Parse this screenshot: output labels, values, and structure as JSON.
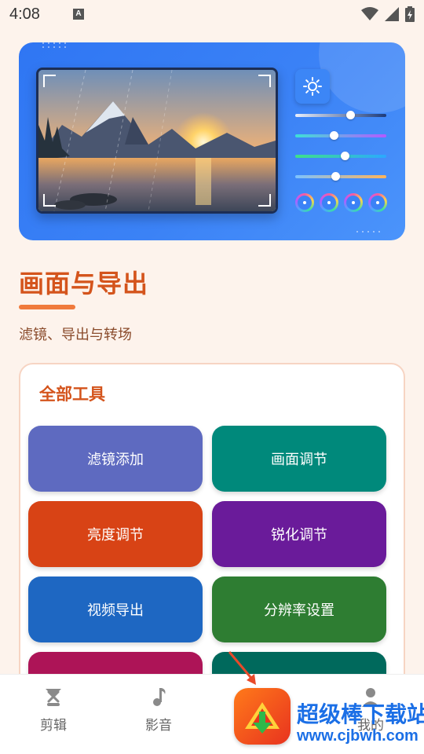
{
  "status_bar": {
    "time": "4:08",
    "notification_icon": "a-icon",
    "wifi_icon": "wifi-icon",
    "signal_icon": "signal-icon",
    "battery_icon": "battery-charging-icon"
  },
  "hero": {
    "image": "mountain-lake-sunset-photo",
    "icons": [
      "sun-icon"
    ],
    "sliders": [
      0.6,
      0.42,
      0.54,
      0.44
    ]
  },
  "section": {
    "title": "画面与导出",
    "subtitle": "滤镜、导出与转场"
  },
  "tools": {
    "heading": "全部工具",
    "items": [
      {
        "label": "滤镜添加",
        "color": "#5e6ac0"
      },
      {
        "label": "画面调节",
        "color": "#00897b"
      },
      {
        "label": "亮度调节",
        "color": "#d84315"
      },
      {
        "label": "锐化调节",
        "color": "#6a1b9a"
      },
      {
        "label": "视频导出",
        "color": "#1e67c2"
      },
      {
        "label": "分辨率设置",
        "color": "#2e7d32"
      },
      {
        "label": "",
        "color": "#ad1457"
      },
      {
        "label": "",
        "color": "#00695c"
      }
    ]
  },
  "nav": {
    "items": [
      {
        "label": "剪辑",
        "icon": "clip-icon"
      },
      {
        "label": "影音",
        "icon": "music-note-icon"
      },
      {
        "label": "",
        "icon": "center-tab-icon"
      },
      {
        "label": "我的",
        "icon": "person-icon"
      }
    ]
  },
  "watermark": {
    "line1": "超级棒下载站",
    "line2": "www.cjbwh.com"
  }
}
